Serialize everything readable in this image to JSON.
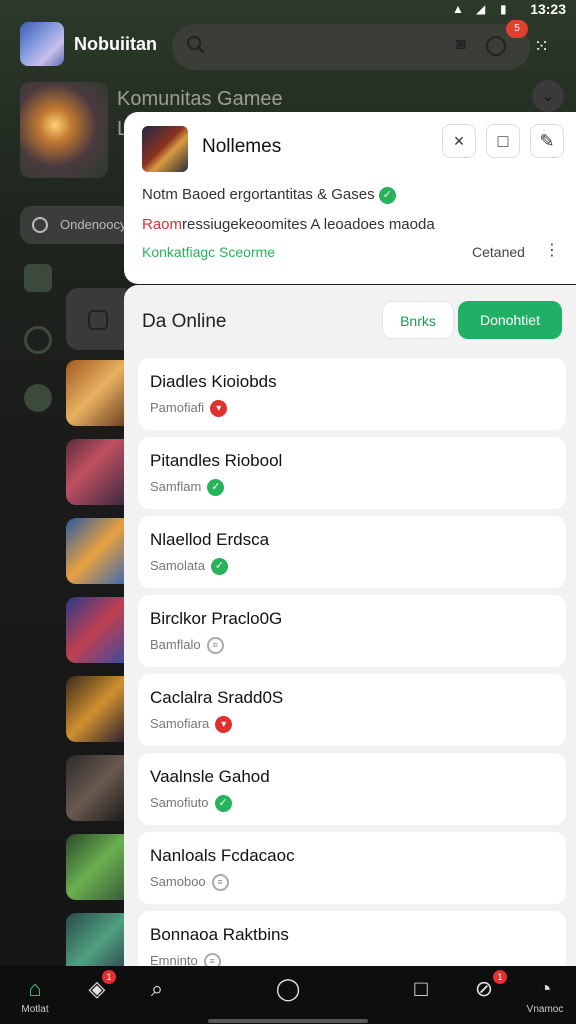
{
  "status_bar": {
    "time": "13:23"
  },
  "header": {
    "title": "Nobuiitan",
    "notification_count": "5"
  },
  "featured": {
    "title": "Komunitas Gamee",
    "subtitle": "L"
  },
  "chip": {
    "label": "Ondenoocy"
  },
  "notification": {
    "title": "Nollemes",
    "line1": "Notm Baoed ergortantitas & Gases",
    "line2_prefix": "Raom",
    "line2_text": "ressiugekeoomites A leoadoes maoda",
    "line3": "Konkatfiagc Sceorme",
    "status": "Cetaned",
    "buttons": {
      "close": "×",
      "window": "□",
      "edit": "✎"
    }
  },
  "online_panel": {
    "title": "Da Online",
    "back_label": "Bnrks",
    "donate_label": "Donohtiet",
    "players": [
      {
        "name": "Diadles Kioiobds",
        "sub": "Pamofiafi",
        "status": "warn"
      },
      {
        "name": "Pitandles Riobool",
        "sub": "Samflam",
        "status": "ok"
      },
      {
        "name": "Nlaellod Erdsca",
        "sub": "Samolata",
        "status": "ok"
      },
      {
        "name": "Birclkor Praclo0G",
        "sub": "Bamflalo",
        "status": "pending"
      },
      {
        "name": "Caclalra Sradd0S",
        "sub": "Samofiara",
        "status": "warn"
      },
      {
        "name": "Vaalnsle Gahod",
        "sub": "Samofiuto",
        "status": "ok"
      },
      {
        "name": "Nanloals Fcdacaoc",
        "sub": "Samoboo",
        "status": "pending"
      },
      {
        "name": "Bonnaoa Raktbins",
        "sub": "Emninto",
        "status": "pending"
      }
    ]
  },
  "bottom_nav": {
    "items": [
      {
        "icon": "home-icon",
        "label": "Motlat"
      },
      {
        "icon": "layers-icon",
        "label": "",
        "badge": "1"
      },
      {
        "icon": "search-icon",
        "label": ""
      },
      {
        "icon": "circle-icon",
        "label": ""
      },
      {
        "icon": "square-icon",
        "label": ""
      },
      {
        "icon": "compass-icon",
        "label": "",
        "badge": "1"
      },
      {
        "icon": "gauge-icon",
        "label": "Vnamoc"
      }
    ]
  },
  "colors": {
    "accent": "#1fb066",
    "warn": "#e03030",
    "ok": "#27b35a"
  }
}
